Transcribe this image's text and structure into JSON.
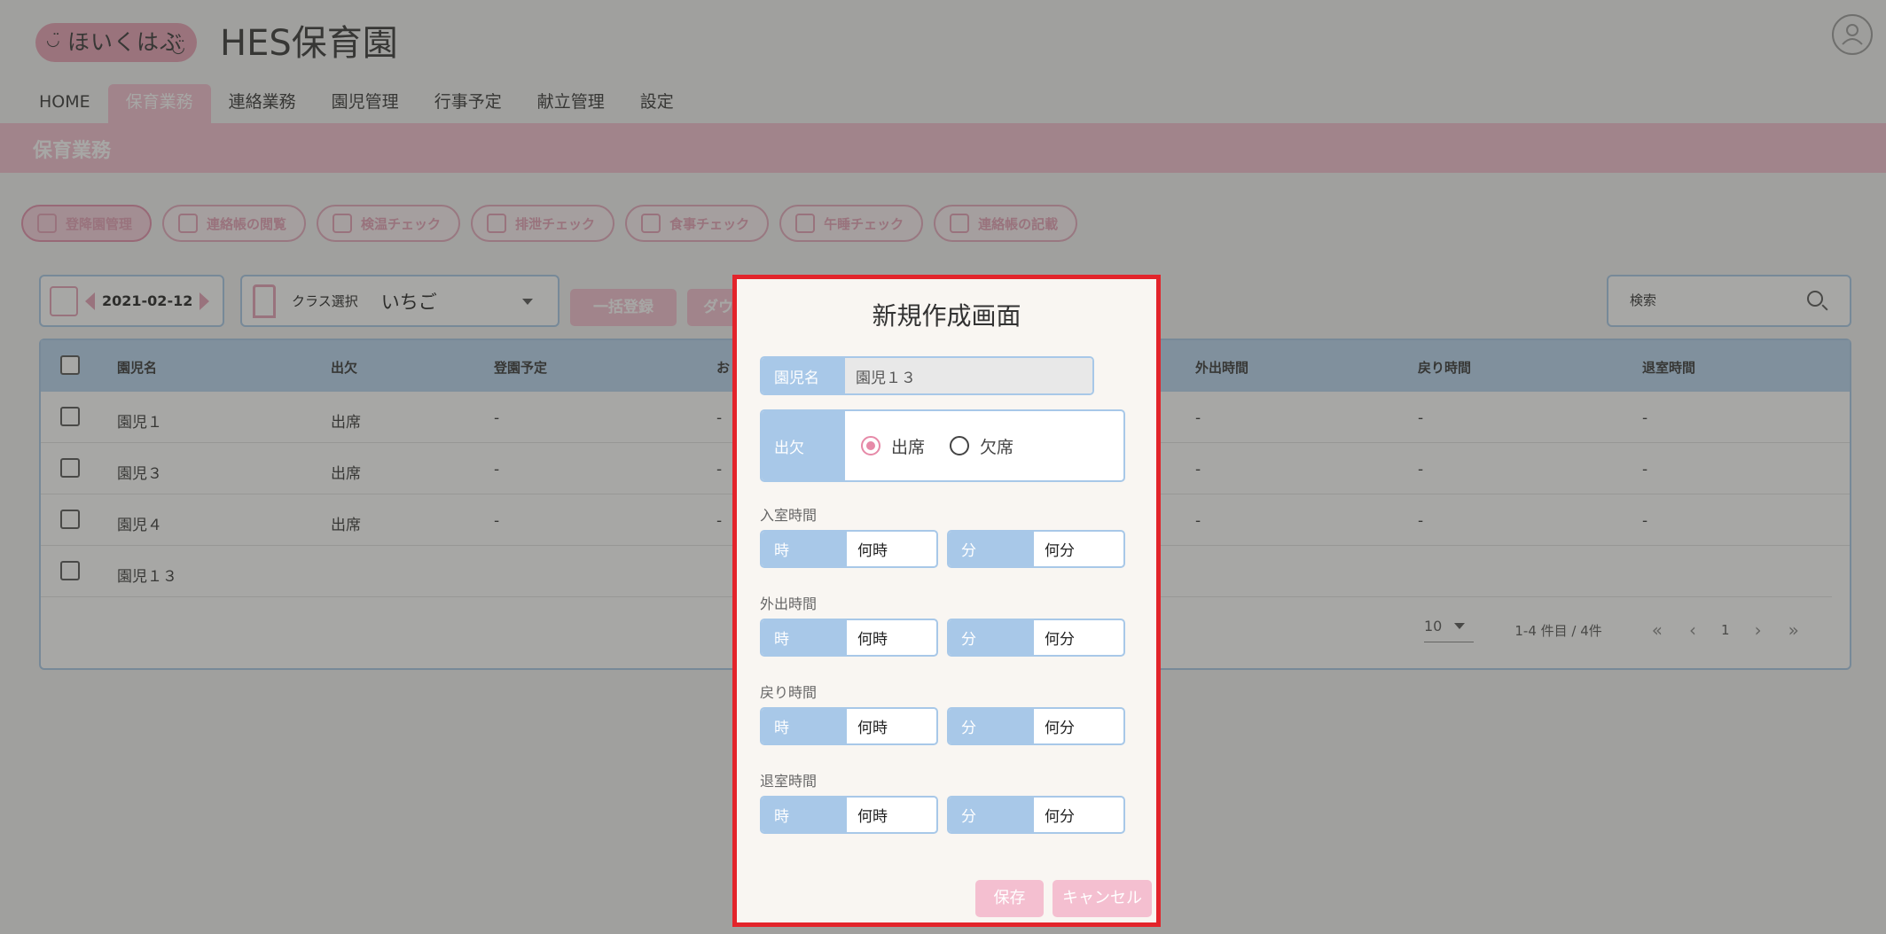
{
  "header": {
    "logo": "ほいくはぶ",
    "site_title": "HES保育園"
  },
  "nav": [
    "HOME",
    "保育業務",
    "連絡業務",
    "園児管理",
    "行事予定",
    "献立管理",
    "設定"
  ],
  "band_title": "保育業務",
  "chips": [
    "登降園管理",
    "連絡帳の閲覧",
    "検温チェック",
    "排泄チェック",
    "食事チェック",
    "午睡チェック",
    "連絡帳の記載"
  ],
  "toolbar": {
    "date": "2021-02-12",
    "class_label": "クラス選択",
    "class_value": "いちご",
    "bulk_button": "一括登録",
    "download_button": "ダウ",
    "search_label": "検索"
  },
  "table": {
    "headers": [
      "園児名",
      "出欠",
      "登園予定",
      "お",
      "外出時間",
      "戻り時間",
      "退室時間"
    ],
    "rows": [
      {
        "name": "園児１",
        "attendance": "出席",
        "plan": "-",
        "col4": "-",
        "out": "-",
        "back": "-",
        "leave": "-"
      },
      {
        "name": "園児３",
        "attendance": "出席",
        "plan": "-",
        "col4": "-",
        "out": "-",
        "back": "-",
        "leave": "-"
      },
      {
        "name": "園児４",
        "attendance": "出席",
        "plan": "-",
        "col4": "-",
        "out": "-",
        "back": "-",
        "leave": "-"
      },
      {
        "name": "園児１３",
        "attendance": "",
        "plan": "",
        "col4": "",
        "out": "",
        "back": "",
        "leave": ""
      }
    ]
  },
  "pagination": {
    "per_page": "10",
    "range": "1-4 件目 / 4件",
    "page": "1"
  },
  "modal": {
    "title": "新規作成画面",
    "name_label": "園児名",
    "name_value": "園児１３",
    "attendance_label": "出欠",
    "present": "出席",
    "absent": "欠席",
    "sections": [
      {
        "label": "入室時間",
        "hour_label": "時",
        "hour_value": "何時",
        "min_label": "分",
        "min_value": "何分"
      },
      {
        "label": "外出時間",
        "hour_label": "時",
        "hour_value": "何時",
        "min_label": "分",
        "min_value": "何分"
      },
      {
        "label": "戻り時間",
        "hour_label": "時",
        "hour_value": "何時",
        "min_label": "分",
        "min_value": "何分"
      },
      {
        "label": "退室時間",
        "hour_label": "時",
        "hour_value": "何時",
        "min_label": "分",
        "min_value": "何分"
      }
    ],
    "save": "保存",
    "cancel": "キャンセル"
  }
}
